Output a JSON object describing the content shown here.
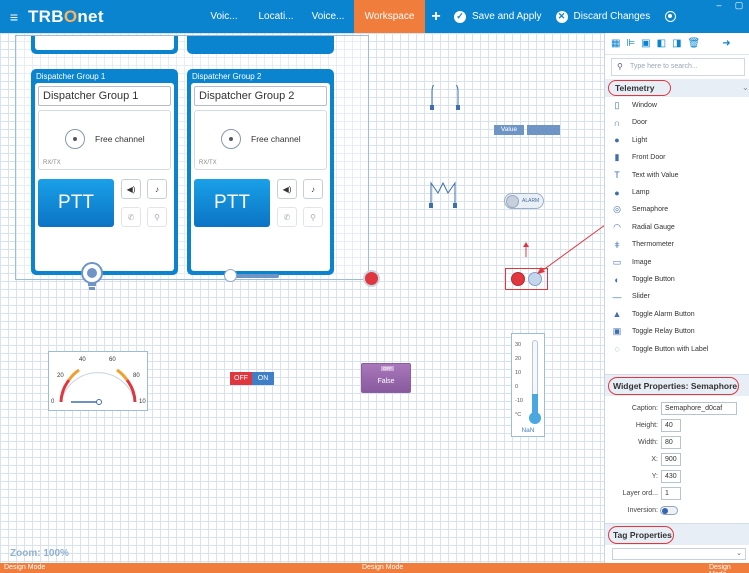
{
  "app": {
    "logo_prefix": "TRB",
    "logo_o": "O",
    "logo_suffix": "net"
  },
  "topbar": {
    "tabs": [
      "Voic...",
      "Locati...",
      "Voice..."
    ],
    "workspace": "Workspace",
    "plus": "+",
    "save_label": "Save and Apply",
    "discard_label": "Discard Changes",
    "win_minimize": "‒",
    "win_maximize": "▢"
  },
  "dispatcher": {
    "groups": [
      {
        "header": "Dispatcher Group 1",
        "name": "Dispatcher Group 1",
        "channel": "Free channel",
        "rxtx": "RX/TX",
        "ptt": "PTT"
      },
      {
        "header": "Dispatcher Group 2",
        "name": "Dispatcher Group 2",
        "channel": "Free channel",
        "rxtx": "RX/TX",
        "ptt": "PTT"
      }
    ]
  },
  "widgets": {
    "value_label": "Value",
    "alarm_label": "ALARM",
    "gauge_ticks": [
      "20",
      "40",
      "60",
      "80",
      "0",
      "10"
    ],
    "off_label": "OFF",
    "on_label": "ON",
    "relay_state_label": "OFF",
    "relay_value": "False",
    "therm_ticks": [
      "30",
      "20",
      "10",
      "0",
      "-10",
      "°C"
    ],
    "therm_value": "NaN"
  },
  "canvas": {
    "zoom": "Zoom: 100%"
  },
  "status": {
    "mode": "Design Mode"
  },
  "panel": {
    "search_placeholder": "Type here to search...",
    "category": "Telemetry",
    "items": [
      {
        "label": "Window",
        "icon": "window-icon"
      },
      {
        "label": "Door",
        "icon": "door-icon"
      },
      {
        "label": "Light",
        "icon": "light-icon"
      },
      {
        "label": "Front Door",
        "icon": "front-door-icon"
      },
      {
        "label": "Text with Value",
        "icon": "text-value-icon"
      },
      {
        "label": "Lamp",
        "icon": "lamp-icon"
      },
      {
        "label": "Semaphore",
        "icon": "semaphore-icon"
      },
      {
        "label": "Radial Gauge",
        "icon": "gauge-icon"
      },
      {
        "label": "Thermometer",
        "icon": "thermometer-icon"
      },
      {
        "label": "Image",
        "icon": "image-icon"
      },
      {
        "label": "Toggle Button",
        "icon": "toggle-icon"
      },
      {
        "label": "Slider",
        "icon": "slider-icon"
      },
      {
        "label": "Toggle Alarm Button",
        "icon": "bell-icon"
      },
      {
        "label": "Toggle Relay Button",
        "icon": "relay-icon"
      },
      {
        "label": "Toggle Button with Label",
        "icon": "toggle-label-icon"
      }
    ],
    "widget_props_title": "Widget Properties: Semaphore",
    "props": {
      "caption_label": "Caption:",
      "caption_value": "Semaphore_d0caf",
      "height_label": "Height:",
      "height_value": "40",
      "width_label": "Width:",
      "width_value": "80",
      "x_label": "X:",
      "x_value": "900",
      "y_label": "Y:",
      "y_value": "430",
      "layer_label": "Layer ord...",
      "layer_value": "1",
      "inversion_label": "Inversion:"
    },
    "tag_props_title": "Tag Properties"
  },
  "colors": {
    "topbar": "#0b84d0",
    "accent": "#f07d3c",
    "alert": "#e0373f"
  }
}
